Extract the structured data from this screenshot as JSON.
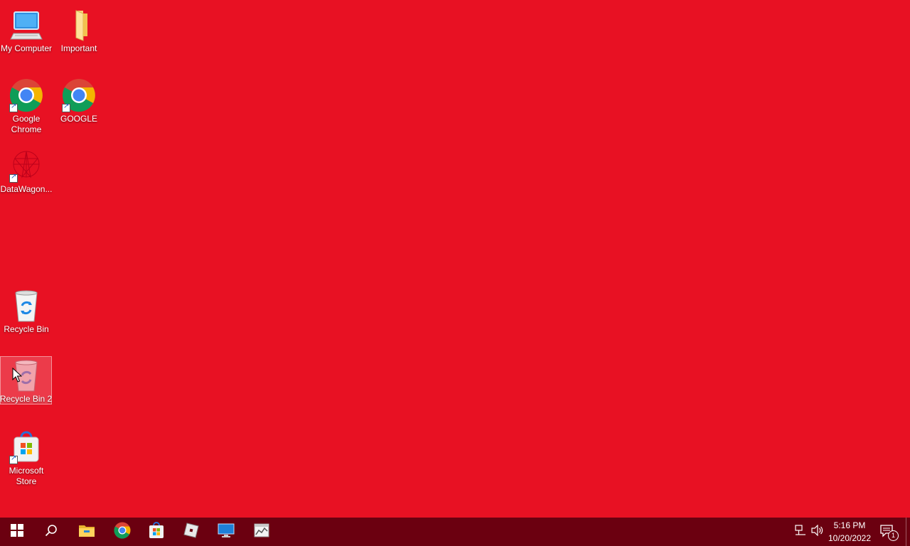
{
  "desktop": {
    "background_color": "#e81123",
    "icons": [
      {
        "label": "My Computer",
        "icon": "computer-icon"
      },
      {
        "label": "Important",
        "icon": "folder-icon"
      },
      {
        "label": "Google Chrome",
        "icon": "chrome-icon",
        "shortcut": true
      },
      {
        "label": "GOOGLE",
        "icon": "chrome-icon",
        "shortcut": true
      },
      {
        "label": "DataWagon...",
        "icon": "datawagon-icon",
        "shortcut": true
      },
      {
        "label": "Recycle Bin",
        "icon": "recycle-bin-icon"
      },
      {
        "label": "Recycle Bin 2",
        "icon": "recycle-bin-icon",
        "selected": true
      },
      {
        "label": "Microsoft Store",
        "icon": "microsoft-store-icon",
        "shortcut": true
      }
    ]
  },
  "taskbar": {
    "background_color": "#6b0010",
    "buttons": [
      {
        "name": "start",
        "icon": "windows-start-icon"
      },
      {
        "name": "search",
        "icon": "search-icon"
      },
      {
        "name": "file-explorer",
        "icon": "file-explorer-icon"
      },
      {
        "name": "chrome",
        "icon": "chrome-icon"
      },
      {
        "name": "microsoft-store",
        "icon": "microsoft-store-icon"
      },
      {
        "name": "roblox",
        "icon": "roblox-icon"
      },
      {
        "name": "remote-desktop",
        "icon": "monitor-icon"
      },
      {
        "name": "app",
        "icon": "chart-app-icon"
      }
    ],
    "tray": {
      "network_icon": "network-icon",
      "volume_icon": "volume-icon",
      "time": "5:16 PM",
      "date": "10/20/2022",
      "notification_icon": "notification-icon",
      "notification_count": "1"
    }
  }
}
